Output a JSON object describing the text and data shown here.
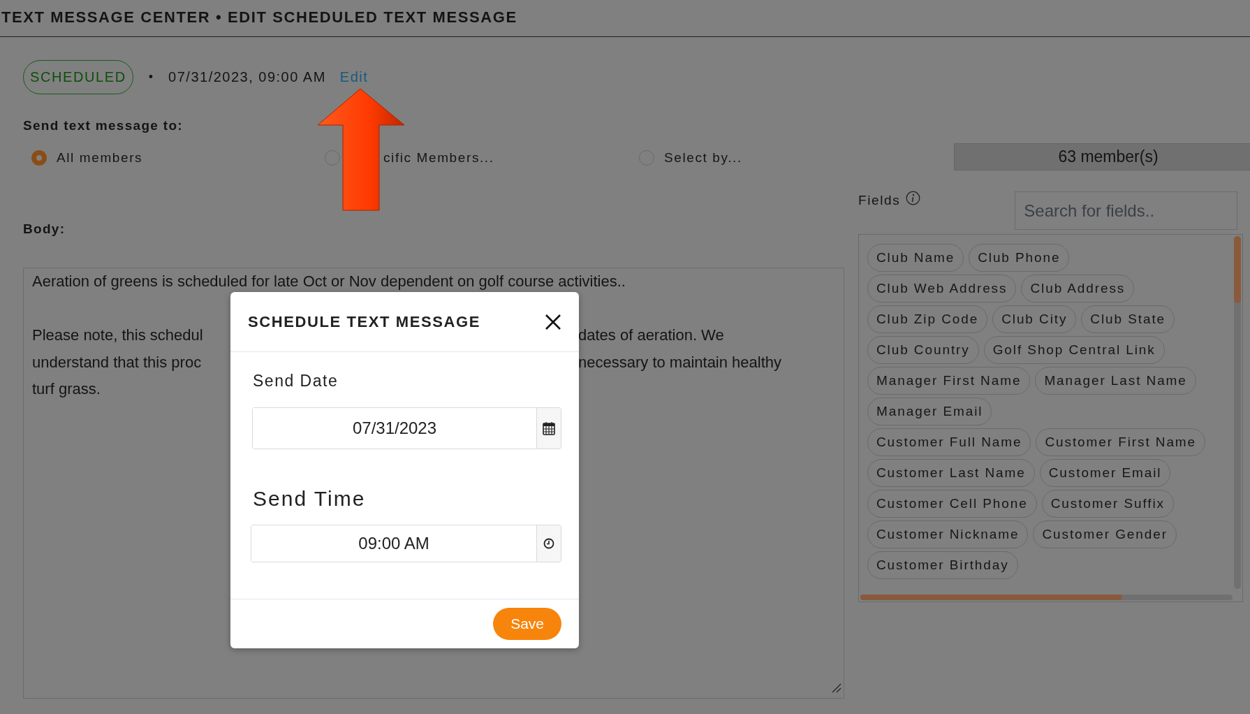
{
  "header": {
    "title": "TEXT MESSAGE CENTER • EDIT SCHEDULED TEXT MESSAGE"
  },
  "status": {
    "badge": "SCHEDULED",
    "bullet": "•",
    "datetime": "07/31/2023, 09:00 AM",
    "edit_link": "Edit"
  },
  "recipients": {
    "label": "Send text message to:",
    "options": [
      {
        "label": "All members",
        "selected": true
      },
      {
        "label": "cific Members...",
        "selected": false
      },
      {
        "label": "Select by...",
        "selected": false
      }
    ],
    "count": "63 member(s)"
  },
  "body": {
    "label": "Body:",
    "paragraphs": [
      [
        {
          "left": "Aeration of greens is scheduled for late Oct or Nov dependent on golf course activities.."
        }
      ],
      [
        {
          "left": "Please note, this schedul",
          "right": "dates of aeration. We"
        },
        {
          "left": "understand that this proc",
          "right": "necessary to maintain healthy"
        },
        {
          "left": "turf grass."
        }
      ]
    ]
  },
  "fields": {
    "label": "Fields",
    "search_placeholder": "Search for fields..",
    "rows": [
      [
        "Club Name",
        "Club Phone"
      ],
      [
        "Club Web Address",
        "Club Address"
      ],
      [
        "Club Zip Code",
        "Club City",
        "Club State"
      ],
      [
        "Club Country",
        "Golf Shop Central Link"
      ],
      [
        "Manager First Name",
        "Manager Last Name"
      ],
      [
        "Manager Email"
      ],
      [
        "Customer Full Name",
        "Customer First Name"
      ],
      [
        "Customer Last Name",
        "Customer Email"
      ],
      [
        "Customer Cell Phone",
        "Customer Suffix"
      ],
      [
        "Customer Nickname",
        "Customer Gender"
      ],
      [
        "Customer Birthday"
      ]
    ]
  },
  "modal": {
    "title": "SCHEDULE TEXT MESSAGE",
    "date_label": "Send Date",
    "date_value": "07/31/2023",
    "time_label": "Send Time",
    "time_value": "09:00 AM",
    "save": "Save"
  }
}
